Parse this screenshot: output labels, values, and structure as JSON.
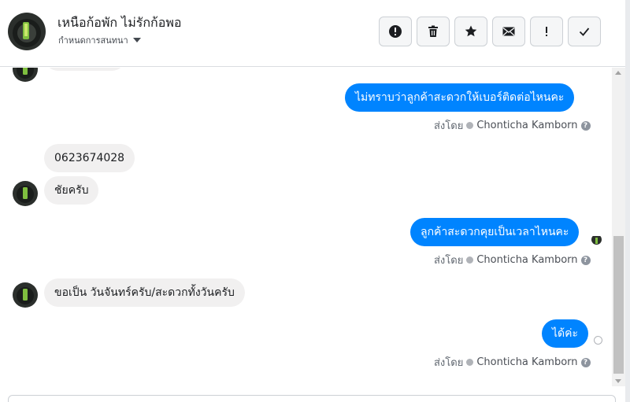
{
  "header": {
    "title": "เหนือก้อพัก ไม่รักก้อพอ",
    "subtitle": "กำหนดการสนทนา",
    "toolbar": [
      {
        "name": "report-button",
        "icon": "exclamation-circle-icon"
      },
      {
        "name": "delete-button",
        "icon": "trash-icon"
      },
      {
        "name": "star-button",
        "icon": "star-icon"
      },
      {
        "name": "mark-unread-button",
        "icon": "envelope-icon"
      },
      {
        "name": "important-button",
        "icon": "exclamation-icon"
      },
      {
        "name": "done-button",
        "icon": "check-icon"
      }
    ]
  },
  "messages": {
    "m1": "ไม่ทราบว่าลูกค้าสะดวกให้เบอร์ติดต่อไหนคะ",
    "m2": "0623674028",
    "m3": "ชัยครับ",
    "m4": "ลูกค้าสะดวกคุยเป็นเวลาไหนคะ",
    "m5": "ขอเป็น วันจันทร์ครับ/สะดวกทั้งวันครับ",
    "m6": "ได้ค่ะ"
  },
  "meta": {
    "sent_by": "ส่งโดย",
    "sender": "Chonticha Kamborn",
    "help": "?"
  },
  "colors": {
    "outgoing": "#0084ff",
    "incoming": "#f1f0f0"
  }
}
